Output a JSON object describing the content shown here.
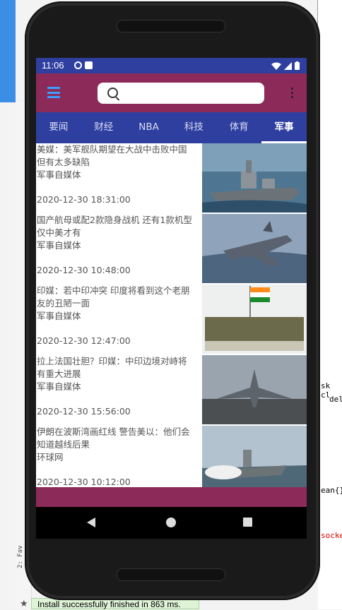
{
  "device": {
    "status_time": "11:06"
  },
  "app": {
    "search": {
      "placeholder": ""
    },
    "tabs": [
      {
        "label": "要闻"
      },
      {
        "label": "财经"
      },
      {
        "label": "NBA"
      },
      {
        "label": "科技"
      },
      {
        "label": "体育"
      },
      {
        "label": "军事",
        "active": true
      }
    ],
    "news": [
      {
        "title": "美媒：美军舰队期望在大战中击败中国 但有太多缺陷",
        "source": "军事自媒体",
        "date": "2020-12-30 18:31:00",
        "thumb": "destroyer-ship"
      },
      {
        "title": "国产航母或配2款隐身战机 还有1款机型仅中美才有",
        "source": "军事自媒体",
        "date": "2020-12-30 10:48:00",
        "thumb": "stealth-jet"
      },
      {
        "title": "印媒：若中印冲突 印度将看到这个老朋友的丑陋一面",
        "source": "军事自媒体",
        "date": "2020-12-30 12:47:00",
        "thumb": "soldiers-flag"
      },
      {
        "title": "拉上法国壮胆？印媒：中印边境对峙将有重大进展",
        "source": "军事自媒体",
        "date": "2020-12-30 15:56:00",
        "thumb": "fighter-runway"
      },
      {
        "title": "伊朗在波斯湾画红线 警告美以：他们会知道越线后果",
        "source": "环球网",
        "date": "2020-12-30 10:12:00",
        "thumb": "missile-boat"
      }
    ]
  },
  "ide": {
    "toast": "Install successfully finished in 863 ms.",
    "code_1": "sk cl",
    "code_2": "del",
    "code_3": "ean{}",
    "code_4": "socke",
    "side_label": "2: Fav"
  },
  "colors": {
    "status_bar": "#2f3f9f",
    "app_bar": "#8c2b5a",
    "tab_bar": "#2f3f9f",
    "menu_icon": "#3aa0ff"
  }
}
